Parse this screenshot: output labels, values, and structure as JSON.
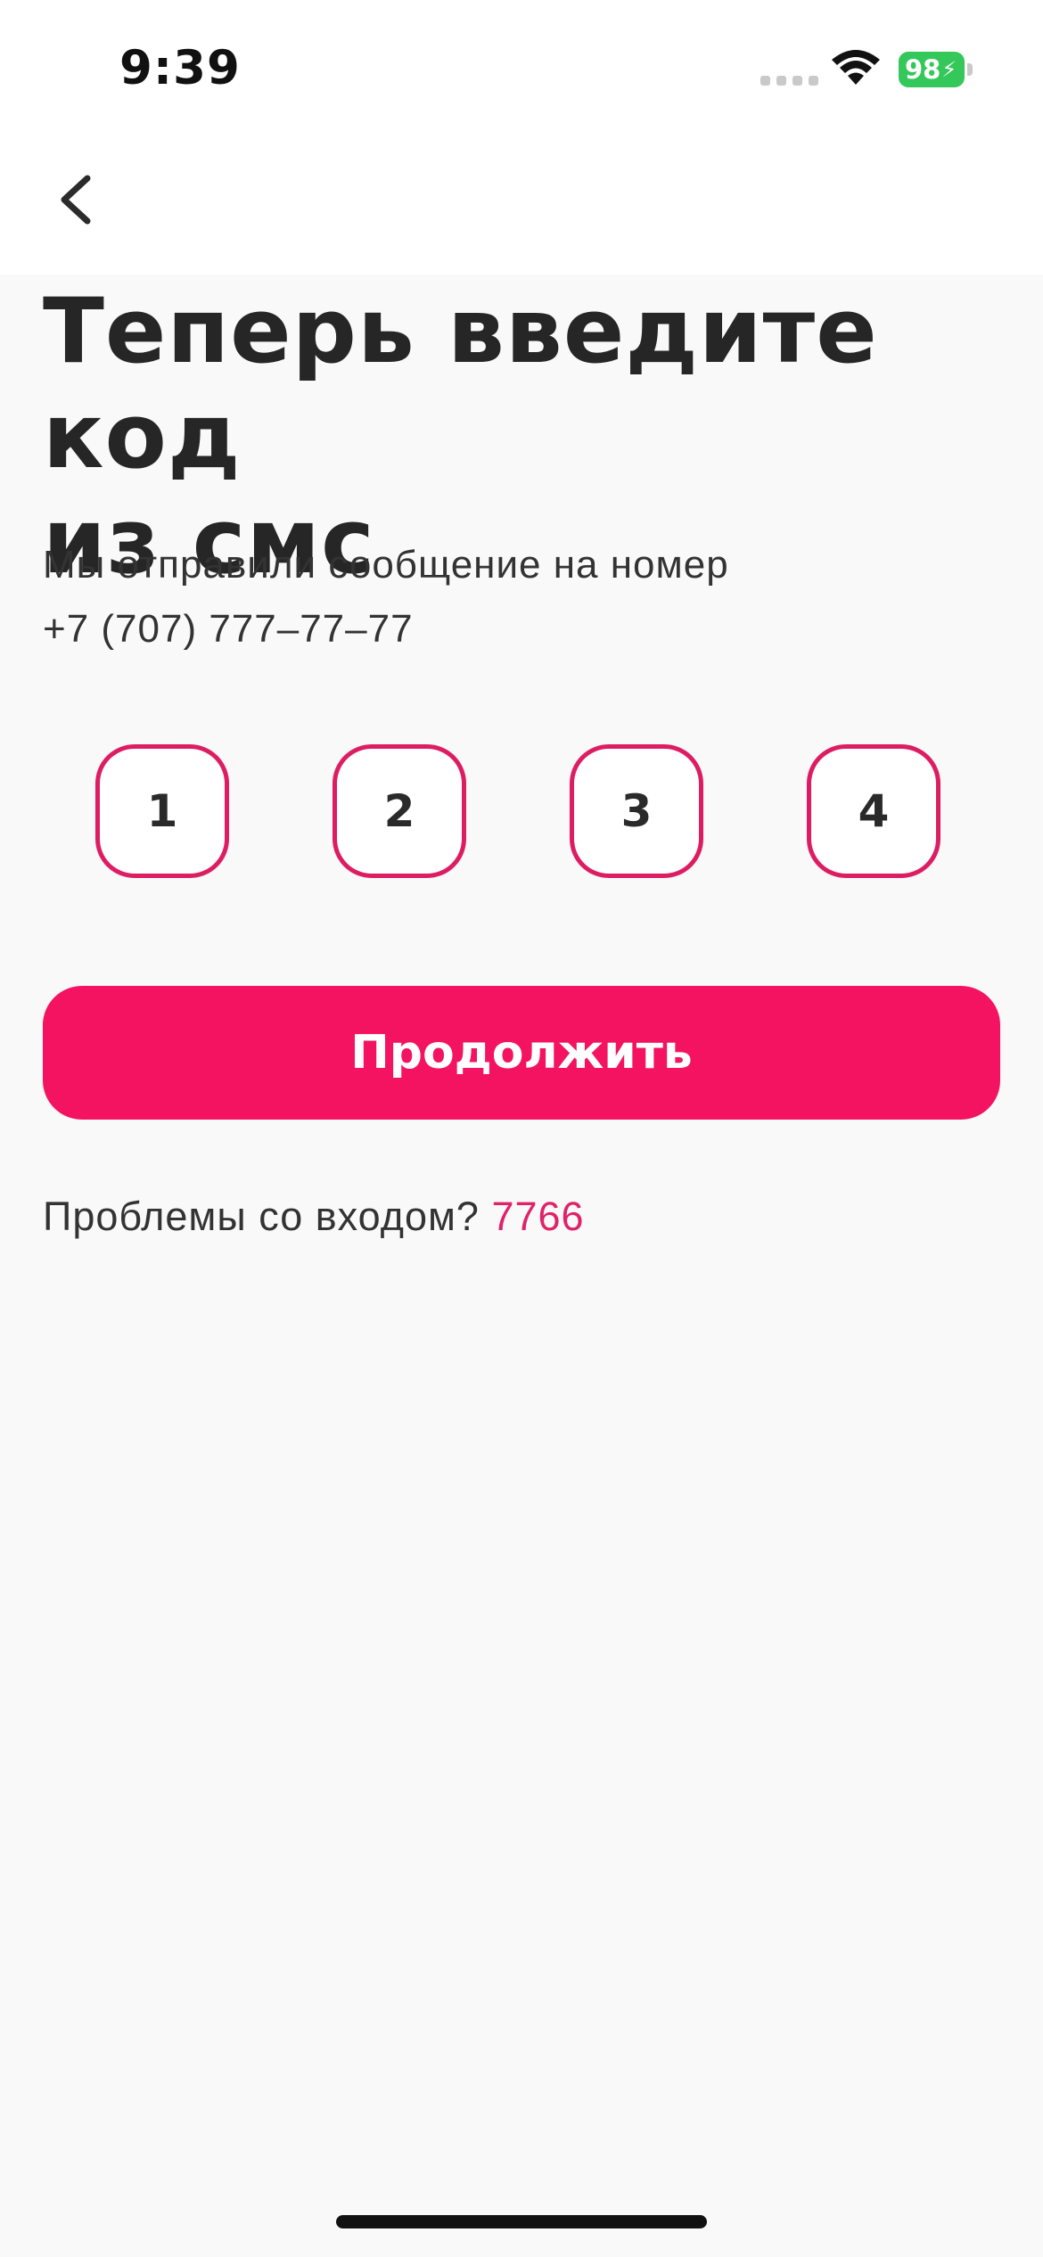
{
  "status_bar": {
    "time": "9:39",
    "battery_level": "98",
    "icons": [
      "cellular-signal-icon",
      "wifi-icon",
      "battery-charging-icon"
    ]
  },
  "navigation": {
    "back_icon": "chevron-left-icon"
  },
  "screen": {
    "title_line1": "Теперь введите код",
    "title_line2": "из смс",
    "subtitle_line1": "Мы отправили сообщение на номер",
    "phone_number": "+7 (707) 777–77–77"
  },
  "code_inputs": [
    "1",
    "2",
    "3",
    "4"
  ],
  "actions": {
    "continue_label": "Продолжить",
    "problems_text": "Проблемы со входом?",
    "problems_link": "7766"
  },
  "colors": {
    "accent": "#f31360",
    "accent_border": "#dd1d62",
    "link": "#e0226a",
    "battery": "#34c759"
  }
}
